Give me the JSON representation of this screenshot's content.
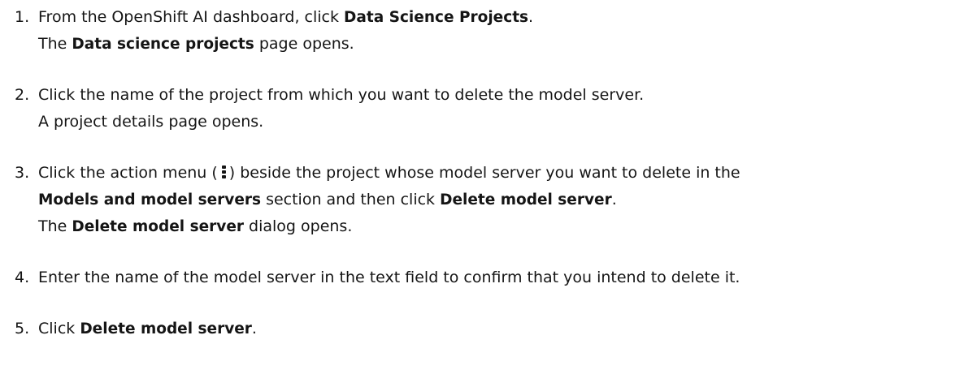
{
  "steps": [
    {
      "number": "1.",
      "lines": [
        [
          "From the OpenShift AI dashboard, click ",
          {
            "b": "Data Science Projects"
          },
          "."
        ],
        [
          "The ",
          {
            "b": "Data science projects"
          },
          " page opens."
        ]
      ]
    },
    {
      "number": "2.",
      "lines": [
        [
          "Click the name of the project from which you want to delete the model server."
        ],
        [
          "A project details page opens."
        ]
      ]
    },
    {
      "number": "3.",
      "lines": [
        [
          "Click the action menu (",
          {
            "icon": "kebab-menu-icon"
          },
          ") beside the project whose model server you want to delete in the"
        ],
        [
          {
            "b": "Models and model servers"
          },
          " section and then click ",
          {
            "b": "Delete model server"
          },
          "."
        ],
        [
          "The ",
          {
            "b": "Delete model server"
          },
          " dialog opens."
        ]
      ]
    },
    {
      "number": "4.",
      "lines": [
        [
          "Enter the name of the model server in the text field to confirm that you intend to delete it."
        ]
      ]
    },
    {
      "number": "5.",
      "lines": [
        [
          "Click ",
          {
            "b": "Delete model server"
          },
          "."
        ]
      ]
    }
  ]
}
